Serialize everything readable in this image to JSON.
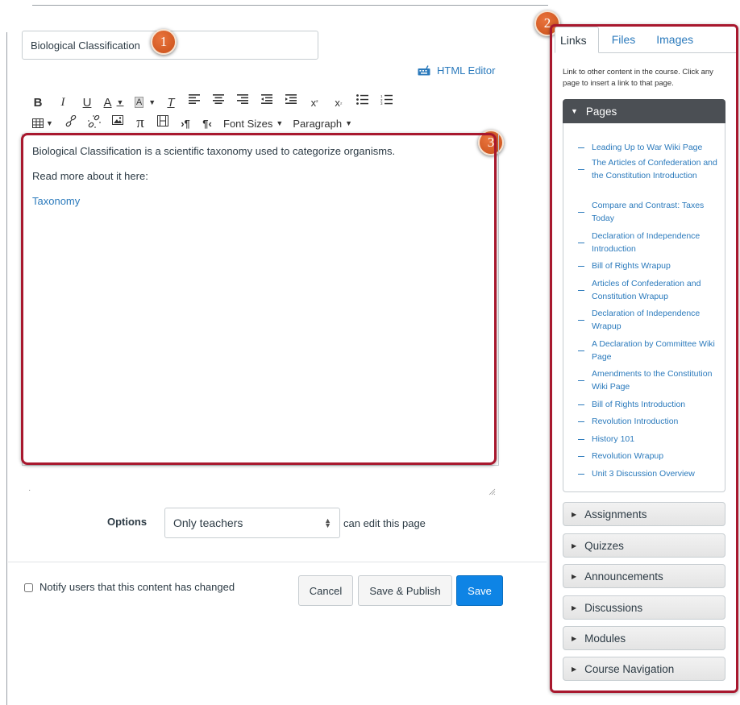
{
  "page": {
    "title_value": "Biological Classification"
  },
  "callouts": [
    "1",
    "2",
    "3"
  ],
  "html_editor_label": "HTML Editor",
  "toolbar": {
    "font_sizes_label": "Font Sizes",
    "paragraph_label": "Paragraph"
  },
  "editor": {
    "paragraph1": "Biological Classification is a scientific taxonomy used to categorize organisms.",
    "paragraph2": "Read more about it here:",
    "link_text": "Taxonomy"
  },
  "options": {
    "label": "Options",
    "selected": "Only teachers",
    "suffix": "can edit this page"
  },
  "footer": {
    "notify_label": "Notify users that this content has changed",
    "cancel": "Cancel",
    "save_publish": "Save & Publish",
    "save": "Save"
  },
  "sidebar": {
    "tabs": [
      "Links",
      "Files",
      "Images"
    ],
    "description": "Link to other content in the course. Click any page to insert a link to that page.",
    "pages_header": "Pages",
    "pages": [
      "Leading Up to War Wiki Page",
      "The Articles of Confederation and the Constitution Introduction",
      "Compare and Contrast: Taxes Today",
      "Declaration of Independence Introduction",
      "Bill of Rights Wrapup",
      "Articles of Confederation and Constitution Wrapup",
      "Declaration of Independence Wrapup",
      "A Declaration by Committee Wiki Page",
      "Amendments to the Constitution Wiki Page",
      "Bill of Rights Introduction",
      "Revolution Introduction",
      "History 101",
      "Revolution Wrapup",
      "Unit 3 Discussion Overview"
    ],
    "sections": [
      "Assignments",
      "Quizzes",
      "Announcements",
      "Discussions",
      "Modules",
      "Course Navigation"
    ]
  },
  "colors": {
    "link": "#2b7abc",
    "highlight": "#a8182e",
    "save_button": "#0e84e5",
    "callout": "#d95f25"
  }
}
